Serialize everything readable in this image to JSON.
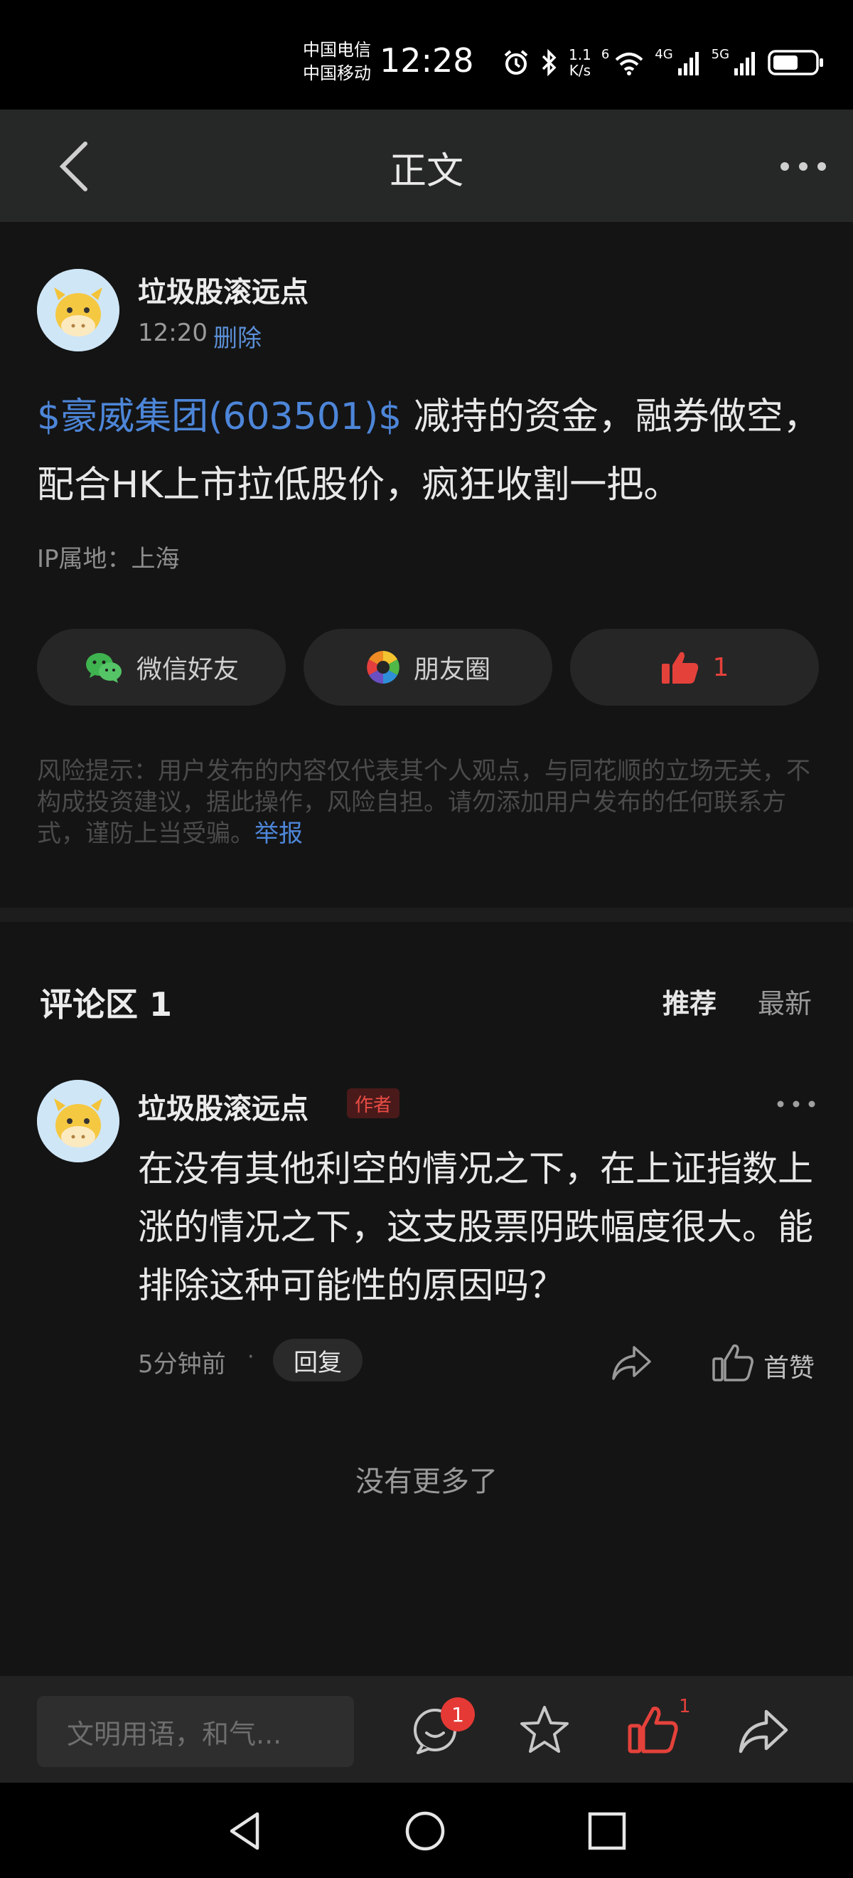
{
  "status_bar": {
    "carrier_1": "中国电信",
    "carrier_2": "中国移动",
    "time": "12:28",
    "net_speed_value": "1.1",
    "net_speed_unit": "K/s",
    "wifi_label": "6",
    "signal_1_label": "4G",
    "signal_2_label": "5G",
    "icons": [
      "alarm-icon",
      "bluetooth-icon",
      "wifi-icon",
      "signal-icon",
      "signal-icon",
      "battery-icon"
    ]
  },
  "nav": {
    "title": "正文",
    "back_icon": "chevron-left-icon",
    "more_icon": "more-dots-icon"
  },
  "post": {
    "author": "垃圾股滚远点",
    "time": "12:20",
    "delete_label": "删除",
    "stock_tag": "$豪威集团(603501)$",
    "content": " 减持的资金，融券做空，配合HK上市拉低股价，疯狂收割一把。",
    "ip_location": "IP属地：上海",
    "share_buttons": {
      "wechat_label": "微信好友",
      "moments_label": "朋友圈",
      "like_count": "1"
    },
    "risk_notice": "风险提示：用户发布的内容仅代表其个人观点，与同花顺的立场无关，不构成投资建议，据此操作，风险自担。请勿添加用户发布的任何联系方式，谨防上当受骗。",
    "report_label": "举报"
  },
  "comments": {
    "title": "评论区 1",
    "sort_recommended": "推荐",
    "sort_latest": "最新",
    "items": [
      {
        "author": "垃圾股滚远点",
        "badge": "作者",
        "text": "在没有其他利空的情况之下，在上证指数上涨的情况之下，这支股票阴跌幅度很大。能排除这种可能性的原因吗？",
        "time": "5分钟前",
        "dot": "·",
        "reply_label": "回复",
        "like_label": "首赞"
      }
    ],
    "no_more": "没有更多了"
  },
  "bottom_bar": {
    "input_placeholder": "文明用语，和气...",
    "comment_badge": "1",
    "like_count": "1"
  },
  "colors": {
    "accent_blue": "#4d86d9",
    "like_red": "#e5413b",
    "background": "#141414"
  }
}
